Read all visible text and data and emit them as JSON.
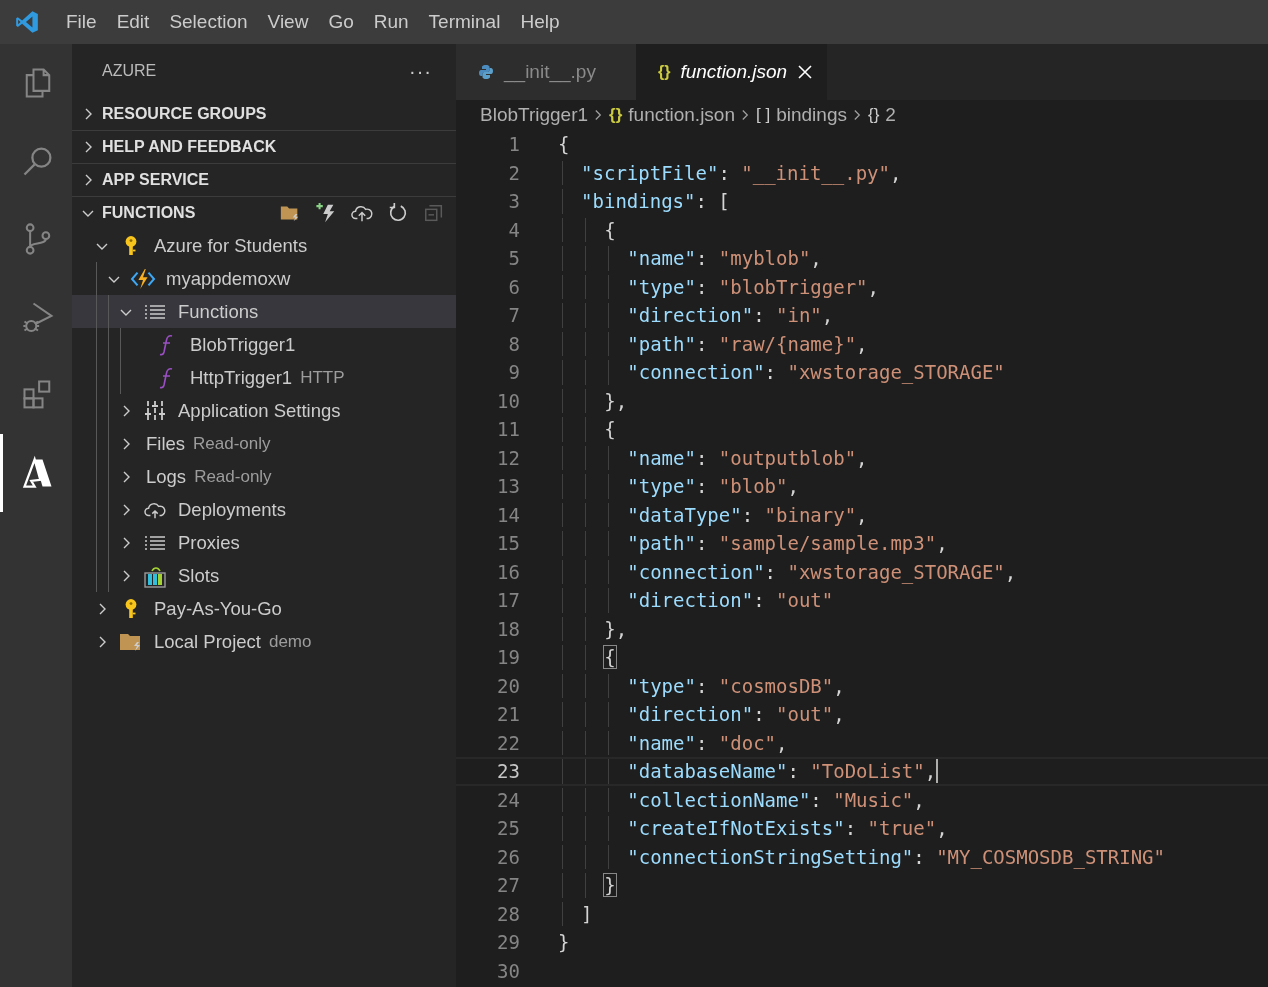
{
  "menu": [
    "File",
    "Edit",
    "Selection",
    "View",
    "Go",
    "Run",
    "Terminal",
    "Help"
  ],
  "activity_bar": [
    {
      "kind": "files",
      "selected": false
    },
    {
      "kind": "search",
      "selected": false
    },
    {
      "kind": "source-control",
      "selected": false
    },
    {
      "kind": "run-debug",
      "selected": false
    },
    {
      "kind": "extensions",
      "selected": false
    },
    {
      "kind": "azure",
      "selected": true
    }
  ],
  "sidebar": {
    "title": "AZURE",
    "more": "···",
    "sections": [
      {
        "label": "RESOURCE GROUPS",
        "expanded": false
      },
      {
        "label": "HELP AND FEEDBACK",
        "expanded": false
      },
      {
        "label": "APP SERVICE",
        "expanded": false
      },
      {
        "label": "FUNCTIONS",
        "expanded": true
      }
    ],
    "tree": [
      {
        "label": "Azure for Students",
        "kind": "key",
        "expanded": true,
        "selected": false,
        "children": [
          {
            "label": "myappdemoxw",
            "kind": "function-app",
            "expanded": true,
            "selected": false,
            "children": [
              {
                "label": "Functions",
                "kind": "list",
                "expanded": true,
                "selected": true,
                "children": [
                  {
                    "label": "BlobTrigger1",
                    "kind": "function",
                    "selected": false
                  },
                  {
                    "label": "HttpTrigger1",
                    "description": "HTTP",
                    "kind": "function",
                    "selected": false
                  }
                ]
              },
              {
                "label": "Application Settings",
                "kind": "settings",
                "expanded": false,
                "selected": false
              },
              {
                "label": "Files",
                "description": "Read-only",
                "kind": "none",
                "expanded": false,
                "selected": false
              },
              {
                "label": "Logs",
                "description": "Read-only",
                "kind": "none",
                "expanded": false,
                "selected": false
              },
              {
                "label": "Deployments",
                "kind": "cloud",
                "expanded": false,
                "selected": false
              },
              {
                "label": "Proxies",
                "kind": "list",
                "expanded": false,
                "selected": false
              },
              {
                "label": "Slots",
                "kind": "slots",
                "expanded": false,
                "selected": false
              }
            ]
          }
        ]
      },
      {
        "label": "Pay-As-You-Go",
        "kind": "key",
        "expanded": false,
        "selected": false
      },
      {
        "label": "Local Project",
        "description": "demo",
        "kind": "folder",
        "expanded": false,
        "selected": false
      }
    ]
  },
  "tabs": [
    {
      "label": "__init__.py",
      "kind": "python",
      "selected": false,
      "preview": false
    },
    {
      "label": "function.json",
      "kind": "json",
      "icon": "{}",
      "selected": true,
      "preview": true
    }
  ],
  "breadcrumb": [
    {
      "label": "BlobTrigger1"
    },
    {
      "icon": "{}",
      "label": "function.json"
    },
    {
      "icon": "[ ]",
      "label": "bindings"
    },
    {
      "icon": "{}",
      "label": "2"
    }
  ],
  "code": [
    {
      "number": "1",
      "kind": "none",
      "selected": false,
      "tokens": [
        {
          "kind": "punct",
          "text": "{"
        }
      ]
    },
    {
      "number": "2",
      "kind": "one",
      "selected": false,
      "tokens": [
        {
          "kind": "key",
          "text": "\"scriptFile\""
        },
        {
          "kind": "punct",
          "text": ": "
        },
        {
          "kind": "string",
          "text": "\"__init__.py\""
        },
        {
          "kind": "punct",
          "text": ","
        }
      ]
    },
    {
      "number": "3",
      "kind": "one",
      "selected": false,
      "tokens": [
        {
          "kind": "key",
          "text": "\"bindings\""
        },
        {
          "kind": "punct",
          "text": ": ["
        }
      ]
    },
    {
      "number": "4",
      "kind": "two",
      "selected": false,
      "tokens": [
        {
          "kind": "punct",
          "text": "{"
        }
      ]
    },
    {
      "number": "5",
      "kind": "three",
      "selected": false,
      "tokens": [
        {
          "kind": "key",
          "text": "\"name\""
        },
        {
          "kind": "punct",
          "text": ": "
        },
        {
          "kind": "string",
          "text": "\"myblob\""
        },
        {
          "kind": "punct",
          "text": ","
        }
      ]
    },
    {
      "number": "6",
      "kind": "three",
      "selected": false,
      "tokens": [
        {
          "kind": "key",
          "text": "\"type\""
        },
        {
          "kind": "punct",
          "text": ": "
        },
        {
          "kind": "string",
          "text": "\"blobTrigger\""
        },
        {
          "kind": "punct",
          "text": ","
        }
      ]
    },
    {
      "number": "7",
      "kind": "three",
      "selected": false,
      "tokens": [
        {
          "kind": "key",
          "text": "\"direction\""
        },
        {
          "kind": "punct",
          "text": ": "
        },
        {
          "kind": "string",
          "text": "\"in\""
        },
        {
          "kind": "punct",
          "text": ","
        }
      ]
    },
    {
      "number": "8",
      "kind": "three",
      "selected": false,
      "tokens": [
        {
          "kind": "key",
          "text": "\"path\""
        },
        {
          "kind": "punct",
          "text": ": "
        },
        {
          "kind": "string",
          "text": "\"raw/{name}\""
        },
        {
          "kind": "punct",
          "text": ","
        }
      ]
    },
    {
      "number": "9",
      "kind": "three",
      "selected": false,
      "tokens": [
        {
          "kind": "key",
          "text": "\"connection\""
        },
        {
          "kind": "punct",
          "text": ": "
        },
        {
          "kind": "string",
          "text": "\"xwstorage_STORAGE\""
        }
      ]
    },
    {
      "number": "10",
      "kind": "two",
      "selected": false,
      "tokens": [
        {
          "kind": "punct",
          "text": "},"
        }
      ]
    },
    {
      "number": "11",
      "kind": "two",
      "selected": false,
      "tokens": [
        {
          "kind": "punct",
          "text": "{"
        }
      ]
    },
    {
      "number": "12",
      "kind": "three",
      "selected": false,
      "tokens": [
        {
          "kind": "key",
          "text": "\"name\""
        },
        {
          "kind": "punct",
          "text": ": "
        },
        {
          "kind": "string",
          "text": "\"outputblob\""
        },
        {
          "kind": "punct",
          "text": ","
        }
      ]
    },
    {
      "number": "13",
      "kind": "three",
      "selected": false,
      "tokens": [
        {
          "kind": "key",
          "text": "\"type\""
        },
        {
          "kind": "punct",
          "text": ": "
        },
        {
          "kind": "string",
          "text": "\"blob\""
        },
        {
          "kind": "punct",
          "text": ","
        }
      ]
    },
    {
      "number": "14",
      "kind": "three",
      "selected": false,
      "tokens": [
        {
          "kind": "key",
          "text": "\"dataType\""
        },
        {
          "kind": "punct",
          "text": ": "
        },
        {
          "kind": "string",
          "text": "\"binary\""
        },
        {
          "kind": "punct",
          "text": ","
        }
      ]
    },
    {
      "number": "15",
      "kind": "three",
      "selected": false,
      "tokens": [
        {
          "kind": "key",
          "text": "\"path\""
        },
        {
          "kind": "punct",
          "text": ": "
        },
        {
          "kind": "string",
          "text": "\"sample/sample.mp3\""
        },
        {
          "kind": "punct",
          "text": ","
        }
      ]
    },
    {
      "number": "16",
      "kind": "three",
      "selected": false,
      "tokens": [
        {
          "kind": "key",
          "text": "\"connection\""
        },
        {
          "kind": "punct",
          "text": ": "
        },
        {
          "kind": "string",
          "text": "\"xwstorage_STORAGE\""
        },
        {
          "kind": "punct",
          "text": ","
        }
      ]
    },
    {
      "number": "17",
      "kind": "three",
      "selected": false,
      "tokens": [
        {
          "kind": "key",
          "text": "\"direction\""
        },
        {
          "kind": "punct",
          "text": ": "
        },
        {
          "kind": "string",
          "text": "\"out\""
        }
      ]
    },
    {
      "number": "18",
      "kind": "two",
      "selected": false,
      "tokens": [
        {
          "kind": "punct",
          "text": "},"
        }
      ]
    },
    {
      "number": "19",
      "kind": "two",
      "selected": false,
      "tokens": [
        {
          "kind": "match",
          "text": "{"
        }
      ]
    },
    {
      "number": "20",
      "kind": "three",
      "selected": false,
      "tokens": [
        {
          "kind": "key",
          "text": "\"type\""
        },
        {
          "kind": "punct",
          "text": ": "
        },
        {
          "kind": "string",
          "text": "\"cosmosDB\""
        },
        {
          "kind": "punct",
          "text": ","
        }
      ]
    },
    {
      "number": "21",
      "kind": "three",
      "selected": false,
      "tokens": [
        {
          "kind": "key",
          "text": "\"direction\""
        },
        {
          "kind": "punct",
          "text": ": "
        },
        {
          "kind": "string",
          "text": "\"out\""
        },
        {
          "kind": "punct",
          "text": ","
        }
      ]
    },
    {
      "number": "22",
      "kind": "three",
      "selected": false,
      "tokens": [
        {
          "kind": "key",
          "text": "\"name\""
        },
        {
          "kind": "punct",
          "text": ": "
        },
        {
          "kind": "string",
          "text": "\"doc\""
        },
        {
          "kind": "punct",
          "text": ","
        }
      ]
    },
    {
      "number": "23",
      "kind": "three",
      "selected": true,
      "tokens": [
        {
          "kind": "key",
          "text": "\"databaseName\""
        },
        {
          "kind": "punct",
          "text": ": "
        },
        {
          "kind": "string",
          "text": "\"ToDoList\""
        },
        {
          "kind": "punct",
          "text": ","
        }
      ]
    },
    {
      "number": "24",
      "kind": "three",
      "selected": false,
      "tokens": [
        {
          "kind": "key",
          "text": "\"collectionName\""
        },
        {
          "kind": "punct",
          "text": ": "
        },
        {
          "kind": "string",
          "text": "\"Music\""
        },
        {
          "kind": "punct",
          "text": ","
        }
      ]
    },
    {
      "number": "25",
      "kind": "three",
      "selected": false,
      "tokens": [
        {
          "kind": "key",
          "text": "\"createIfNotExists\""
        },
        {
          "kind": "punct",
          "text": ": "
        },
        {
          "kind": "string",
          "text": "\"true\""
        },
        {
          "kind": "punct",
          "text": ","
        }
      ]
    },
    {
      "number": "26",
      "kind": "three",
      "selected": false,
      "tokens": [
        {
          "kind": "key",
          "text": "\"connectionStringSetting\""
        },
        {
          "kind": "punct",
          "text": ": "
        },
        {
          "kind": "string",
          "text": "\"MY_COSMOSDB_STRING\""
        }
      ]
    },
    {
      "number": "27",
      "kind": "two",
      "selected": false,
      "tokens": [
        {
          "kind": "match",
          "text": "}"
        }
      ]
    },
    {
      "number": "28",
      "kind": "one",
      "selected": false,
      "tokens": [
        {
          "kind": "punct",
          "text": "]"
        }
      ]
    },
    {
      "number": "29",
      "kind": "none",
      "selected": false,
      "tokens": [
        {
          "kind": "punct",
          "text": "}"
        }
      ]
    },
    {
      "number": "30",
      "kind": "none",
      "selected": false
    }
  ]
}
